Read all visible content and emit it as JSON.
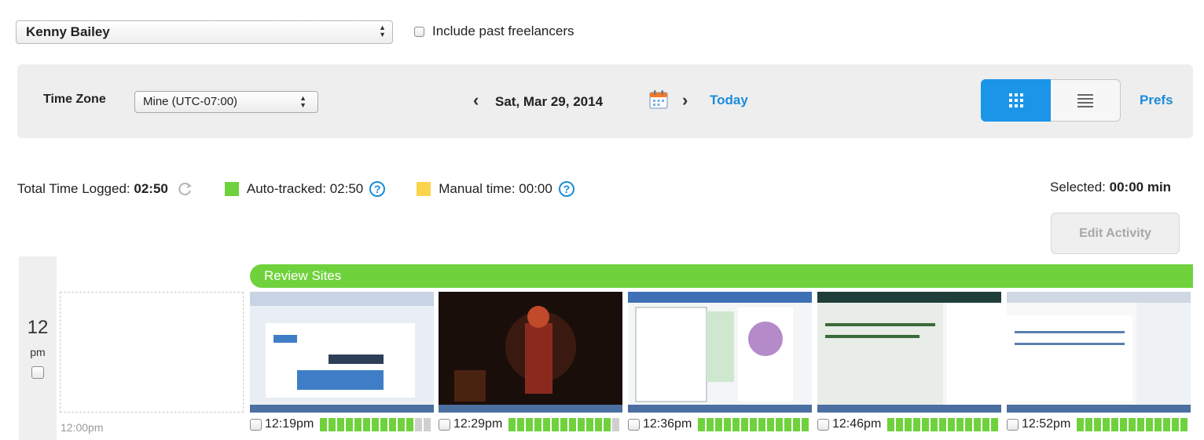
{
  "freelancer": {
    "selected": "Kenny Bailey",
    "include_past_label": "Include past freelancers"
  },
  "toolbar": {
    "timezone_label": "Time Zone",
    "timezone_value": "Mine (UTC-07:00)",
    "date": "Sat, Mar 29, 2014",
    "today_label": "Today",
    "prefs_label": "Prefs",
    "views": [
      "grid-view",
      "list-view"
    ],
    "active_view": "grid-view"
  },
  "stats": {
    "total_label": "Total Time Logged:",
    "total_value": "02:50",
    "auto_label": "Auto-tracked: 02:50",
    "manual_label": "Manual time: 00:00",
    "selected_label": "Selected:",
    "selected_value": "00:00 min",
    "edit_label": "Edit Activity",
    "colors": {
      "auto": "#6fd23c",
      "manual": "#fcd34d",
      "accent": "#1b95e8"
    }
  },
  "timeline": {
    "hour": "12",
    "ampm": "pm",
    "empty_slot_time": "12:00pm",
    "memo": "Review Sites",
    "screenshots": [
      {
        "time": "12:19pm",
        "activity": [
          1,
          1,
          1,
          1,
          1,
          1,
          1,
          1,
          1,
          1,
          1,
          0,
          0
        ],
        "theme": "browser"
      },
      {
        "time": "12:29pm",
        "activity": [
          1,
          1,
          1,
          1,
          1,
          1,
          1,
          1,
          1,
          1,
          1,
          1,
          0
        ],
        "theme": "wallpaper"
      },
      {
        "time": "12:36pm",
        "activity": [
          1,
          1,
          1,
          1,
          1,
          1,
          1,
          1,
          1,
          1,
          1,
          1,
          1
        ],
        "theme": "spreadsheet"
      },
      {
        "time": "12:46pm",
        "activity": [
          1,
          1,
          1,
          1,
          1,
          1,
          1,
          1,
          1,
          1,
          1,
          1,
          1
        ],
        "theme": "email"
      },
      {
        "time": "12:52pm",
        "activity": [
          1,
          1,
          1,
          1,
          1,
          1,
          1,
          1,
          1,
          1,
          1,
          1,
          1
        ],
        "theme": "sheet"
      }
    ]
  }
}
